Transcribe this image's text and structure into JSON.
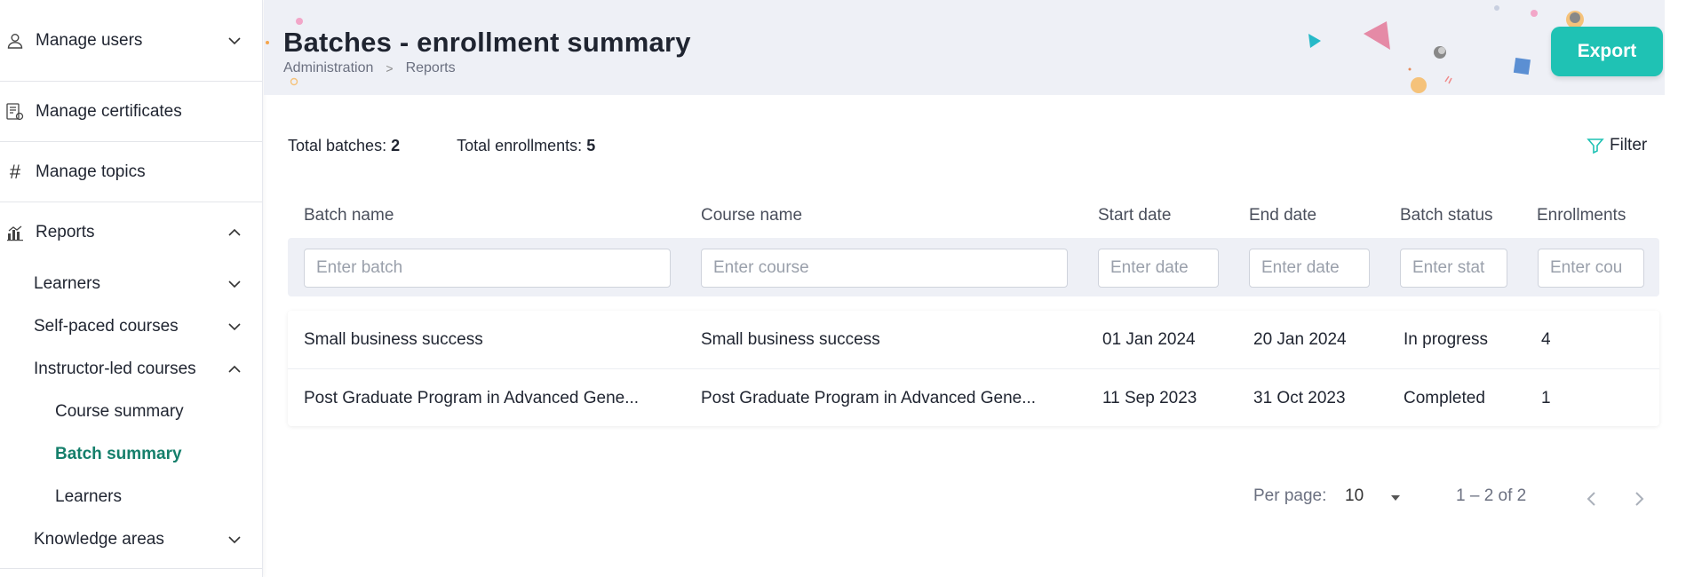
{
  "sidebar": {
    "manage_users": "Manage users",
    "manage_certificates": "Manage certificates",
    "manage_topics": "Manage topics",
    "reports": "Reports",
    "learners": "Learners",
    "self_paced": "Self-paced courses",
    "instructor_led": "Instructor-led courses",
    "course_summary": "Course summary",
    "batch_summary": "Batch summary",
    "il_learners": "Learners",
    "knowledge_areas": "Knowledge areas"
  },
  "header": {
    "title": "Batches - enrollment summary",
    "breadcrumb": [
      "Administration",
      "Reports"
    ],
    "export_label": "Export"
  },
  "summary": {
    "total_batches_label": "Total batches:",
    "total_batches": "2",
    "total_enrollments_label": "Total enrollments:",
    "total_enrollments": "5",
    "filter_label": "Filter"
  },
  "table": {
    "columns": [
      "Batch name",
      "Course name",
      "Start date",
      "End date",
      "Batch status",
      "Enrollments"
    ],
    "placeholders": [
      "Enter batch",
      "Enter course",
      "Enter date",
      "Enter date",
      "Enter stat",
      "Enter cou"
    ],
    "rows": [
      [
        "Small business success",
        "Small business success",
        "01 Jan 2024",
        "20 Jan 2024",
        "In progress",
        "4"
      ],
      [
        "Post Graduate Program in Advanced Gene...",
        "Post Graduate Program in Advanced Gene...",
        "11 Sep 2023",
        "31 Oct 2023",
        "Completed",
        "1"
      ]
    ]
  },
  "pagination": {
    "per_page_label": "Per page:",
    "per_page_value": "10",
    "range": "1 – 2 of 2"
  },
  "colors": {
    "accent": "#1fc2b4",
    "active_nav": "#157f6b",
    "header_bg": "#eef0f6"
  }
}
